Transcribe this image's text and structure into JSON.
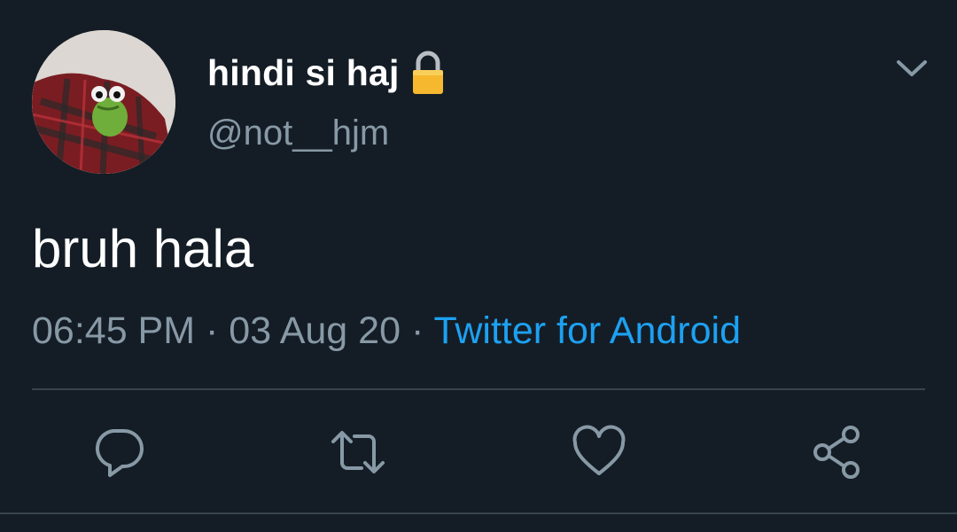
{
  "user": {
    "display_name": "hindi si haj",
    "handle": "@not__hjm",
    "avatar_icon": "avatar-kermit-blanket",
    "lock_icon": "lock-icon"
  },
  "tweet": {
    "text": "bruh hala",
    "time": "06:45 PM",
    "separator": "·",
    "date": "03 Aug 20",
    "source": "Twitter for Android"
  },
  "actions": {
    "reply_icon": "reply-icon",
    "retweet_icon": "retweet-icon",
    "like_icon": "heart-icon",
    "share_icon": "share-icon",
    "menu_icon": "chevron-down-icon"
  },
  "colors": {
    "background": "#141d26",
    "text": "#ffffff",
    "muted": "#8899a6",
    "accent": "#1da1f2",
    "divider": "#38444d"
  }
}
